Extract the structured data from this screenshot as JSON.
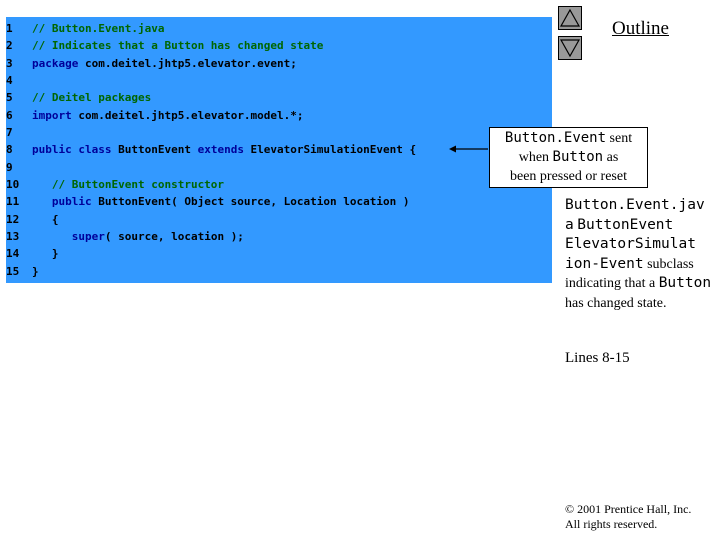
{
  "code": {
    "line_numbers": [
      "1",
      "2",
      "3",
      "4",
      "5",
      "6",
      "7",
      "8",
      "9",
      "10",
      "11",
      "12",
      "13",
      "14",
      "15"
    ],
    "lines": [
      [
        {
          "t": "// Button.Event.java",
          "k": "comment"
        }
      ],
      [
        {
          "t": "// Indicates that a Button has changed state",
          "k": "comment"
        }
      ],
      [
        {
          "t": "package",
          "k": "keyword"
        },
        {
          "t": " com.deitel.jhtp5.elevator.event;",
          "k": "plain"
        }
      ],
      [],
      [
        {
          "t": "// Deitel packages",
          "k": "comment"
        }
      ],
      [
        {
          "t": "import",
          "k": "keyword"
        },
        {
          "t": " com.deitel.jhtp5.elevator.model.*;",
          "k": "plain"
        }
      ],
      [],
      [
        {
          "t": "public class",
          "k": "keyword"
        },
        {
          "t": " ButtonEvent ",
          "k": "plain"
        },
        {
          "t": "extends",
          "k": "keyword"
        },
        {
          "t": " ElevatorSimulationEvent {",
          "k": "plain"
        }
      ],
      [],
      [
        {
          "t": "   // ButtonEvent constructor",
          "k": "comment"
        }
      ],
      [
        {
          "t": "   public",
          "k": "keyword"
        },
        {
          "t": " ButtonEvent( Object source, Location location )",
          "k": "plain"
        }
      ],
      [
        {
          "t": "   {",
          "k": "plain"
        }
      ],
      [
        {
          "t": "      super",
          "k": "keyword"
        },
        {
          "t": "( source, location );",
          "k": "plain"
        }
      ],
      [
        {
          "t": "   }",
          "k": "plain"
        }
      ],
      [
        {
          "t": "}",
          "k": "plain"
        }
      ]
    ]
  },
  "nav": {
    "up_icon": "triangle-up-icon",
    "down_icon": "triangle-down-icon"
  },
  "outline_label": "Outline",
  "callout": {
    "part1": "Button.Event",
    "part2": " sent",
    "part3": "when ",
    "part4": "Button",
    "part5": " as",
    "part6": "been pressed or reset"
  },
  "side_note": {
    "p1": "Button.Event.jav a",
    "p2": " ",
    "p3": "ButtonEvent",
    "p4": " ",
    "p5": "ElevatorSimulat ion-Event",
    "p6": " subclass indicating that a ",
    "p7": "Button",
    "p8": " has changed state."
  },
  "lines_ref": "Lines 8-15",
  "copyright": {
    "line1": "© 2001 Prentice Hall, Inc.",
    "line2": "All rights reserved."
  },
  "colors": {
    "code_bg": "#3399ff",
    "comment": "#006600",
    "keyword": "#000099",
    "nav_button": "#999999"
  }
}
